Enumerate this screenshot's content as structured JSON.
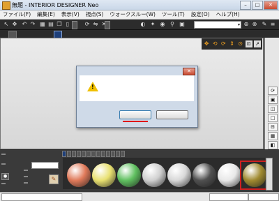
{
  "window": {
    "title": "無題 - INTERIOR DESIGNER Neo",
    "controls": {
      "minimize": "–",
      "maximize": "□",
      "close": "✕"
    }
  },
  "menu": [
    "ファイル(F)",
    "編集(E)",
    "表示(V)",
    "視点(S)",
    "ウォークスルー(W)",
    "ツール(T)",
    "設定(O)",
    "ヘルプ(H)"
  ],
  "toolbar": {
    "mode_label": "",
    "toggle_button": "",
    "view_select": "",
    "view_arrow": "▾"
  },
  "tabs": [
    {
      "label": "",
      "active": false
    },
    {
      "label": "",
      "active": true
    }
  ],
  "viewport": {
    "label": ""
  },
  "dialog": {
    "title": "",
    "message": "",
    "warning_glyph": "!",
    "yes_label": "",
    "no_label": "",
    "close": "✕"
  },
  "bottom_panel": {
    "parts_label": "",
    "texture_label": "",
    "target_label": "",
    "target_value": "",
    "color_edit": "",
    "color_add": "",
    "color_sort": "",
    "walk_label": "",
    "spoit_label": ""
  },
  "categories": [
    {
      "label": "",
      "active": true
    },
    {
      "label": "",
      "active": false
    },
    {
      "label": "",
      "active": false
    },
    {
      "label": "",
      "active": false
    },
    {
      "label": "",
      "active": false
    },
    {
      "label": "",
      "active": false
    },
    {
      "label": "",
      "active": false
    },
    {
      "label": "",
      "active": false
    },
    {
      "label": "",
      "active": false
    },
    {
      "label": "",
      "active": false
    },
    {
      "label": "",
      "active": false
    },
    {
      "label": "",
      "active": false
    },
    {
      "label": "",
      "active": false
    }
  ],
  "materials": [
    {
      "label": "",
      "color": "#e07a5a",
      "selected": false
    },
    {
      "label": "",
      "color": "#e8e070",
      "selected": false
    },
    {
      "label": "",
      "color": "#60c060",
      "selected": false
    },
    {
      "label": "",
      "color": "#cfcfcf",
      "selected": false
    },
    {
      "label": "",
      "color": "#d8d8d8",
      "selected": false
    },
    {
      "label": "",
      "color": "#505050",
      "selected": false
    },
    {
      "label": "",
      "color": "#e8e8e8",
      "selected": false
    },
    {
      "label": "",
      "color": "#a08a30",
      "selected": true
    }
  ],
  "status": {
    "left": "",
    "middle": "",
    "right": ""
  },
  "colors": {
    "accent": "#1e3f7a",
    "highlight_red": "#e00000",
    "warning": "#f0c000"
  }
}
